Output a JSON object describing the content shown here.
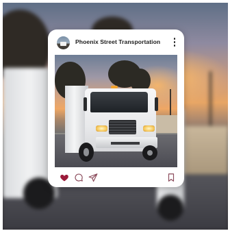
{
  "post": {
    "account_name": "Phoenix Street Transportation",
    "avatar": "account-avatar",
    "menu_icon": "more-vertical-icon",
    "photo": "street-sweeper-truck-photo",
    "actions": {
      "like_icon": "heart-icon",
      "like_state": "liked",
      "comment_icon": "comment-icon",
      "share_icon": "send-icon",
      "save_icon": "bookmark-icon"
    }
  },
  "colors": {
    "like": "#9b1b3a",
    "icon": "#8a4a5a",
    "text": "#1c1c1c"
  }
}
